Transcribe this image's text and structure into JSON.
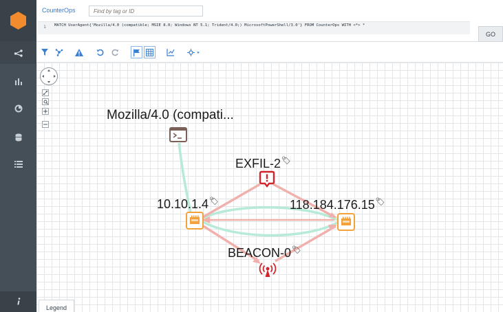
{
  "app": {
    "title": "CounterOps"
  },
  "search": {
    "placeholder": "Find by tag or ID"
  },
  "query": {
    "line_number": "1",
    "text": "MATCH UserAgent{'Mozilla/4.0 (compatible; MSIE 8.0; Windows NT 5.1; Trident/4.0;) MicrosoftPowerShell/3.0'} FROM CounterOps WITH <*> *"
  },
  "go_label": "GO",
  "legend_label": "Legend",
  "colors": {
    "sidebar": "#454f57",
    "accent": "#f28a2e",
    "threat": "#d2242b",
    "host": "#f3a23a",
    "edge_red": "#f0b1ad",
    "edge_green": "#b7ead7"
  },
  "nodes": {
    "useragent": {
      "label": "Mozilla/4.0 (compati...",
      "icon": "terminal-icon"
    },
    "exfil": {
      "label": "EXFIL-2",
      "icon": "exfil-alert-icon"
    },
    "host_a": {
      "label": "10.10.1.4",
      "icon": "host-icon"
    },
    "host_b": {
      "label": "118.184.176.15",
      "icon": "host-icon"
    },
    "beacon": {
      "label": "BEACON-0",
      "icon": "beacon-icon"
    }
  },
  "sidebar": {
    "items": [
      {
        "name": "share-nodes-icon"
      },
      {
        "name": "bar-chart-icon"
      },
      {
        "name": "pie-chart-icon"
      },
      {
        "name": "database-icon"
      },
      {
        "name": "list-icon"
      }
    ],
    "info_icon": "info-icon"
  },
  "toolbar_icons": [
    "filter-icon",
    "layout-icon",
    "warning-icon",
    "undo-icon",
    "redo-icon",
    "flag-icon",
    "grid-icon",
    "chart-edit-icon",
    "move-icon"
  ]
}
